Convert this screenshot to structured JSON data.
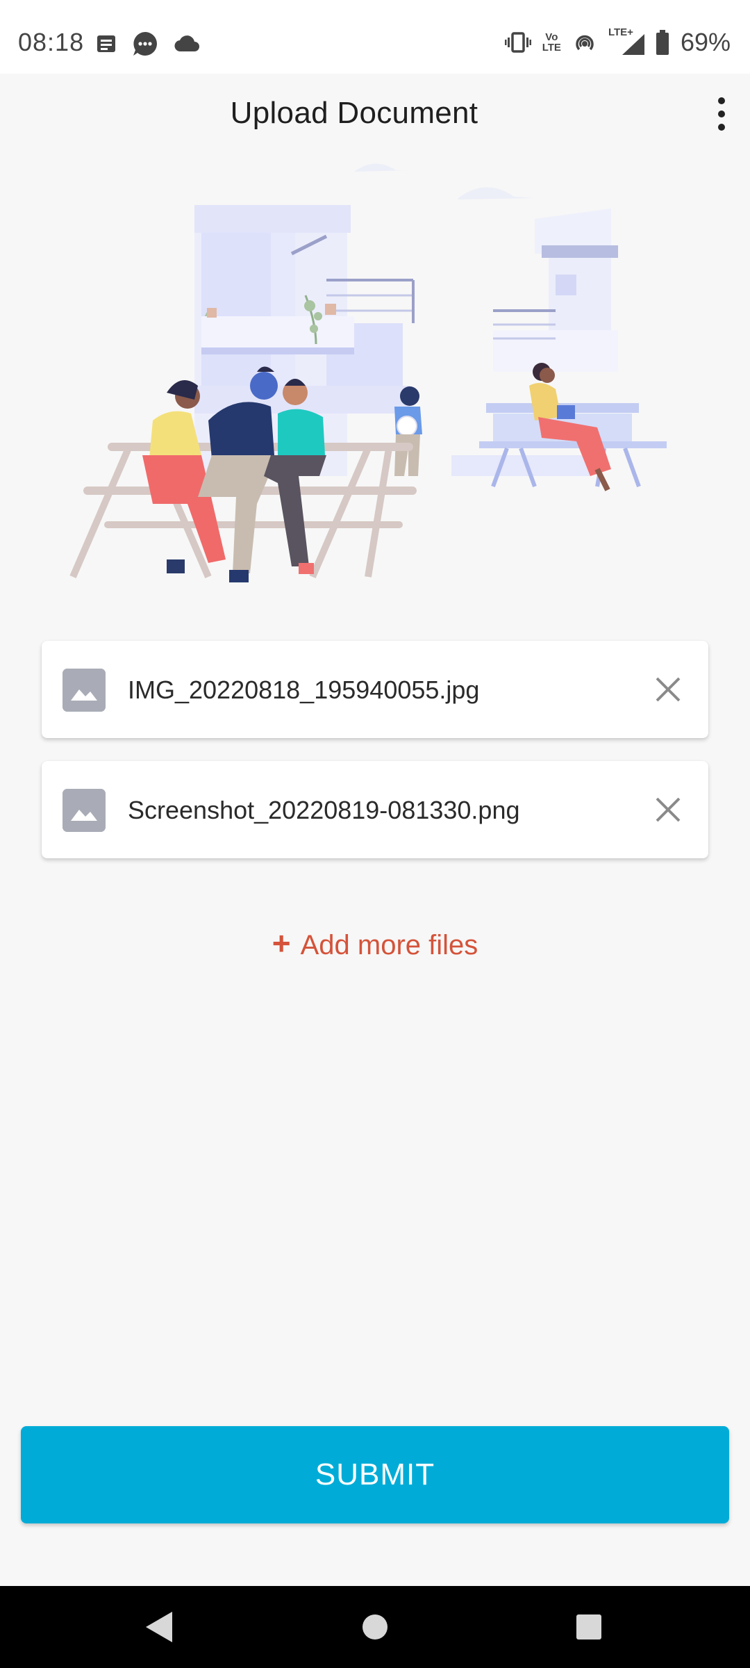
{
  "status_bar": {
    "time": "08:18",
    "battery": "69%",
    "volte_top": "Vo",
    "volte_bottom": "LTE",
    "lte_label": "LTE+",
    "left_icons": [
      "notes-icon",
      "chat-bubble-icon",
      "cloud-icon"
    ],
    "right_icons": [
      "vibrate-icon",
      "volte-icon",
      "hotspot-icon",
      "signal-icon",
      "battery-icon"
    ]
  },
  "app_bar": {
    "title": "Upload Document",
    "menu_icon": "more-vert-icon"
  },
  "files": [
    {
      "name": "IMG_20220818_195940055.jpg",
      "icon": "image-icon",
      "remove_icon": "close-icon"
    },
    {
      "name": "Screenshot_20220819-081330.png",
      "icon": "image-icon",
      "remove_icon": "close-icon"
    }
  ],
  "add_more": {
    "plus": "+",
    "label": "Add more files"
  },
  "submit": {
    "label": "SUBMIT"
  },
  "colors": {
    "accent": "#00acd7",
    "link": "#d4533a",
    "background": "#f7f7f7"
  },
  "nav_bar": {
    "icons": [
      "back-icon",
      "home-icon",
      "recents-icon"
    ]
  }
}
